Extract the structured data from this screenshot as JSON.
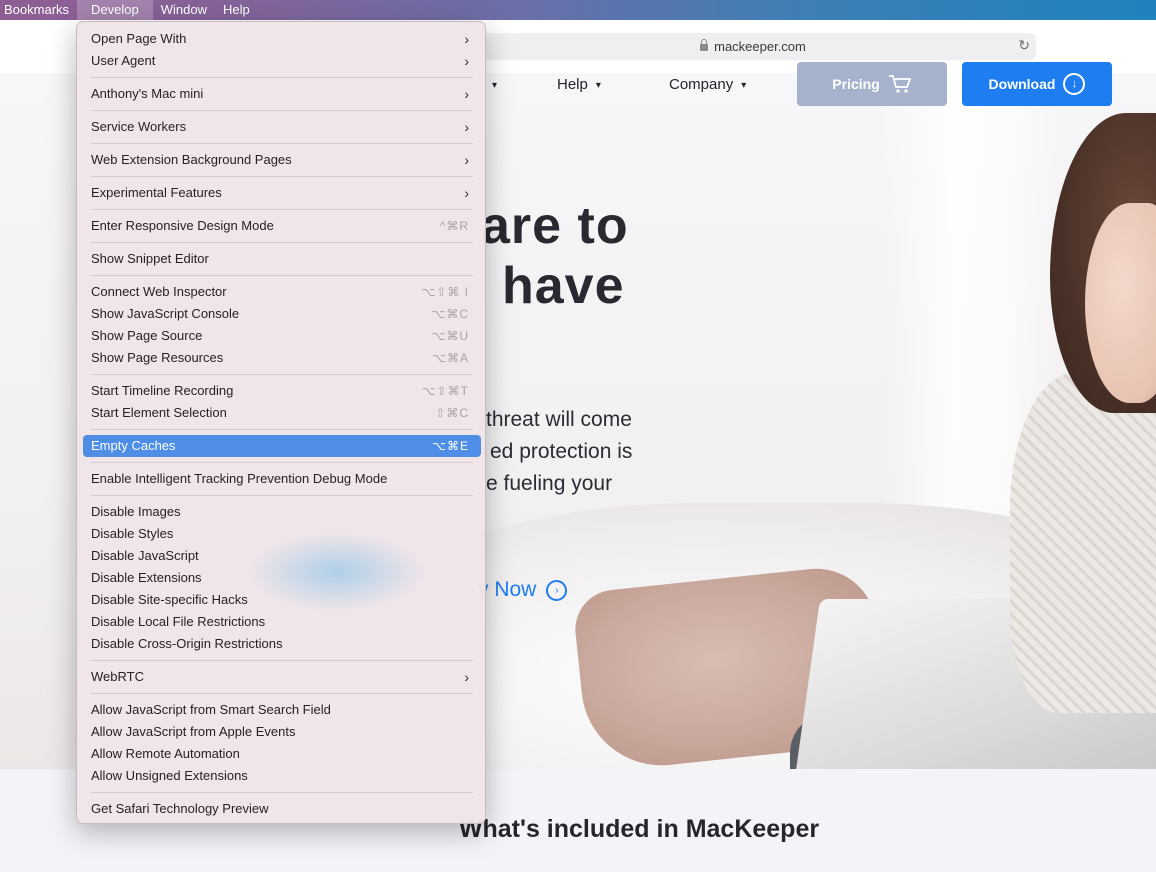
{
  "menubar": {
    "items": [
      "Bookmarks",
      "Develop",
      "Window",
      "Help"
    ]
  },
  "browser": {
    "url": "mackeeper.com",
    "reload_icon": "reload-icon"
  },
  "site": {
    "nav": {
      "help": "Help",
      "company": "Company"
    },
    "pricing": "Pricing",
    "download": "Download",
    "headline_line1": "are to",
    "headline_line2": "have",
    "para_line1": "threat will come",
    "para_line2": "ed protection is",
    "para_line3": "e fueling your",
    "cta": "y Now",
    "included_title": "What's included in MacKeeper"
  },
  "develop_menu": {
    "items": [
      {
        "label": "Open Page With",
        "submenu": true
      },
      {
        "label": "User Agent",
        "submenu": true
      },
      {
        "label": "Anthony's Mac mini",
        "submenu": true
      },
      {
        "label": "Service Workers",
        "submenu": true
      },
      {
        "label": "Web Extension Background Pages",
        "submenu": true
      },
      {
        "label": "Experimental Features",
        "submenu": true
      },
      {
        "label": "Enter Responsive Design Mode",
        "shortcut": "^⌘R"
      },
      {
        "label": "Show Snippet Editor"
      },
      {
        "label": "Connect Web Inspector",
        "shortcut": "⌥⇧⌘ I"
      },
      {
        "label": "Show JavaScript Console",
        "shortcut": "⌥⌘C"
      },
      {
        "label": "Show Page Source",
        "shortcut": "⌥⌘U"
      },
      {
        "label": "Show Page Resources",
        "shortcut": "⌥⌘A"
      },
      {
        "label": "Start Timeline Recording",
        "shortcut": "⌥⇧⌘T"
      },
      {
        "label": "Start Element Selection",
        "shortcut": "⇧⌘C"
      },
      {
        "label": "Empty Caches",
        "shortcut": "⌥⌘E",
        "highlighted": true
      },
      {
        "label": "Enable Intelligent Tracking Prevention Debug Mode"
      },
      {
        "label": "Disable Images"
      },
      {
        "label": "Disable Styles"
      },
      {
        "label": "Disable JavaScript"
      },
      {
        "label": "Disable Extensions"
      },
      {
        "label": "Disable Site-specific Hacks"
      },
      {
        "label": "Disable Local File Restrictions"
      },
      {
        "label": "Disable Cross-Origin Restrictions"
      },
      {
        "label": "WebRTC",
        "submenu": true
      },
      {
        "label": "Allow JavaScript from Smart Search Field"
      },
      {
        "label": "Allow JavaScript from Apple Events"
      },
      {
        "label": "Allow Remote Automation"
      },
      {
        "label": "Allow Unsigned Extensions"
      },
      {
        "label": "Get Safari Technology Preview"
      }
    ]
  },
  "colors": {
    "accent": "#1e7df0",
    "menu_highlight": "#4e8ee6",
    "pricing_button": "#a6b1cc"
  }
}
